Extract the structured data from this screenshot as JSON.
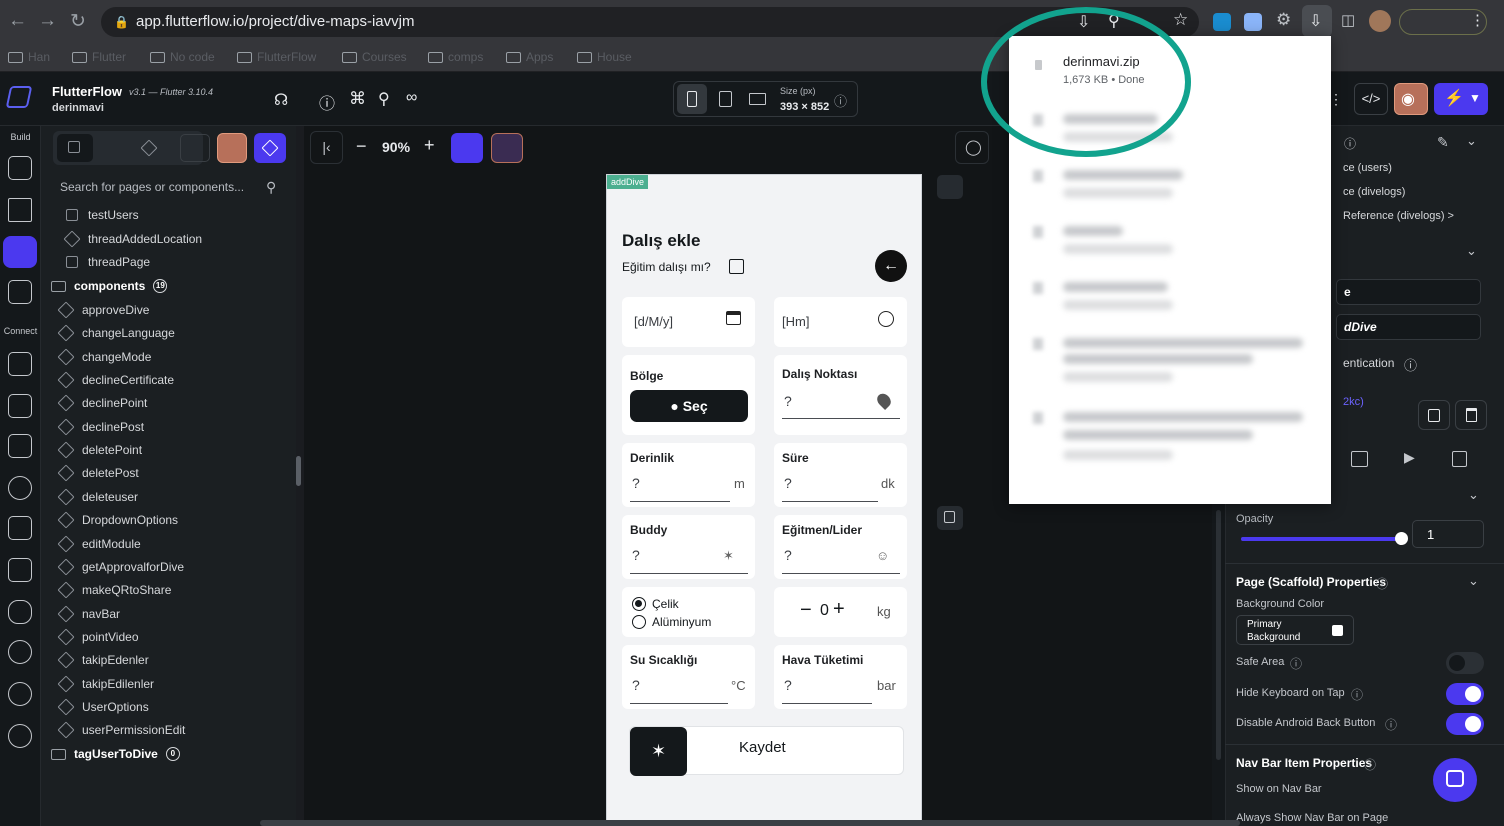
{
  "browser": {
    "url": "app.flutterflow.io/project/dive-maps-iavvjm",
    "bookmarks": [
      "Han",
      "Flutter",
      "No code",
      "FlutterFlow",
      "Courses",
      "comps",
      "Apps",
      "House"
    ]
  },
  "downloads": {
    "file_name": "derinmavi.zip",
    "file_status": "1,673 KB • Done",
    "highlight_color": "#12a38e"
  },
  "app": {
    "name": "FlutterFlow",
    "version": "v3.1 — Flutter 3.10.4",
    "project": "derinmavi",
    "zoom": "90%",
    "size_label": "Size (px)",
    "size_value": "393 × 852",
    "accent": "#4b39ef"
  },
  "rail": {
    "build_label": "Build",
    "connect_label": "Connect"
  },
  "left_panel": {
    "search_placeholder": "Search for pages or components...",
    "pages": [
      "testUsers",
      "threadAddedLocation",
      "threadPage"
    ],
    "components_label": "components",
    "components_count": "19",
    "components": [
      "approveDive",
      "changeLanguage",
      "changeMode",
      "declineCertificate",
      "declinePoint",
      "declinePost",
      "deletePoint",
      "deletePost",
      "deleteuser",
      "DropdownOptions",
      "editModule",
      "getApprovalforDive",
      "makeQRtoShare",
      "navBar",
      "pointVideo",
      "takipEdenler",
      "takipEdilenler",
      "UserOptions",
      "userPermissionEdit"
    ],
    "folder2_label": "tagUserToDive",
    "folder2_count": "0"
  },
  "phone": {
    "tag": "addDive",
    "title": "Dalış ekle",
    "training_question": "Eğitim dalışı mı?",
    "date_placeholder": "[d/M/y]",
    "time_placeholder": "[Hm]",
    "region_label": "Bölge",
    "select_button": "Seç",
    "dive_point_label": "Dalış Noktası",
    "depth_label": "Derinlik",
    "depth_unit": "m",
    "duration_label": "Süre",
    "duration_unit": "dk",
    "buddy_label": "Buddy",
    "instructor_label": "Eğitmen/Lider",
    "tank_steel": "Çelik",
    "tank_aluminium": "Alüminyum",
    "stepper_value": "0",
    "stepper_unit": "kg",
    "water_temp_label": "Su Sıcaklığı",
    "water_temp_unit": "°C",
    "air_usage_label": "Hava Tüketimi",
    "air_usage_unit": "bar",
    "placeholder": "?",
    "save_button": "Kaydet"
  },
  "right_panel": {
    "ref_users": "ce (users)",
    "ref_divelogs": "ce (divelogs)",
    "ref_divelogs_full": "Reference (divelogs) >",
    "field_a": "e",
    "field_b": "dDive",
    "authentication": "entication",
    "code_badge": "2kc)",
    "opacity_label": "Opacity",
    "opacity_value": "1",
    "opacity_level": 1.0,
    "page_props_title": "Page (Scaffold) Properties",
    "bg_color_label": "Background Color",
    "bg_color_value": "Primary Background",
    "safe_area_label": "Safe Area",
    "safe_area_on": false,
    "hide_keyboard_label": "Hide Keyboard on Tap",
    "hide_keyboard_on": true,
    "disable_back_label": "Disable Android Back Button",
    "disable_back_on": true,
    "navbar_props_title": "Nav Bar Item Properties",
    "show_navbar_label": "Show on Nav Bar",
    "always_show_label": "Always Show Nav Bar on Page"
  }
}
